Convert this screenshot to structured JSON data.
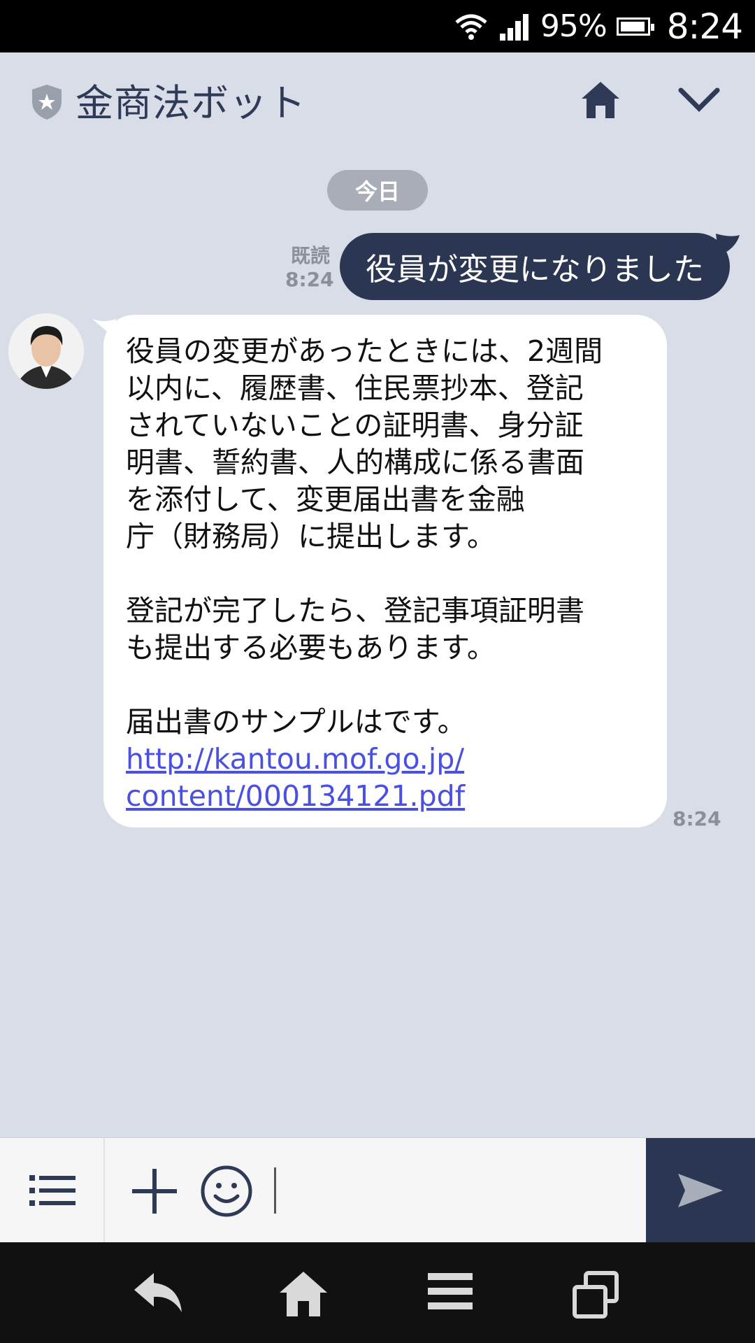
{
  "status": {
    "battery_percent": "95%",
    "time": "8:24"
  },
  "header": {
    "title": "金商法ボット"
  },
  "date_divider": "今日",
  "outgoing": {
    "read_label": "既読",
    "time": "8:24",
    "text": "役員が変更になりました"
  },
  "incoming": {
    "paragraph1": "役員の変更があったときには、2週間\n以内に、履歴書、住民票抄本、登記\nされていないことの証明書、身分証\n明書、誓約書、人的構成に係る書面\nを添付して、変更届出書を金融\n庁（財務局）に提出します。",
    "paragraph2": "登記が完了したら、登記事項証明書\nも提出する必要もあります。",
    "paragraph3": "届出書のサンプルはです。",
    "link": "http://kantou.mof.go.jp/\ncontent/000134121.pdf",
    "time": "8:24"
  },
  "input": {
    "placeholder": ""
  },
  "colors": {
    "background": "#d8dde8",
    "accent_navy": "#2b3652",
    "link": "#4a50e0"
  },
  "icons": [
    "wifi-icon",
    "signal-icon",
    "battery-icon",
    "shield-star-icon",
    "home-icon",
    "chevron-down-icon",
    "menu-list-icon",
    "plus-icon",
    "emoji-icon",
    "send-icon",
    "back-icon",
    "nav-home-icon",
    "nav-menu-icon",
    "recent-apps-icon"
  ]
}
